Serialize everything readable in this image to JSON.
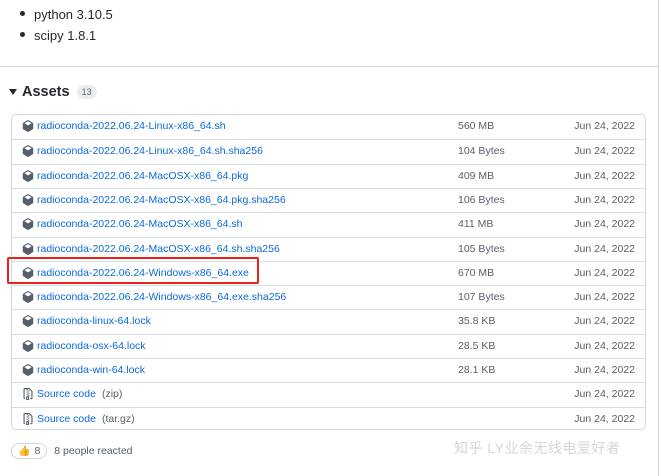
{
  "dependencies": [
    "python 3.10.5",
    "scipy 1.8.1"
  ],
  "assets": {
    "title": "Assets",
    "count": "13",
    "rows": [
      {
        "name": "radioconda-2022.06.24-Linux-x86_64.sh",
        "sub": "",
        "size": "560 MB",
        "date": "Jun 24, 2022",
        "icon": "package-icon"
      },
      {
        "name": "radioconda-2022.06.24-Linux-x86_64.sh.sha256",
        "sub": "",
        "size": "104 Bytes",
        "date": "Jun 24, 2022",
        "icon": "package-icon"
      },
      {
        "name": "radioconda-2022.06.24-MacOSX-x86_64.pkg",
        "sub": "",
        "size": "409 MB",
        "date": "Jun 24, 2022",
        "icon": "package-icon"
      },
      {
        "name": "radioconda-2022.06.24-MacOSX-x86_64.pkg.sha256",
        "sub": "",
        "size": "106 Bytes",
        "date": "Jun 24, 2022",
        "icon": "package-icon"
      },
      {
        "name": "radioconda-2022.06.24-MacOSX-x86_64.sh",
        "sub": "",
        "size": "411 MB",
        "date": "Jun 24, 2022",
        "icon": "package-icon"
      },
      {
        "name": "radioconda-2022.06.24-MacOSX-x86_64.sh.sha256",
        "sub": "",
        "size": "105 Bytes",
        "date": "Jun 24, 2022",
        "icon": "package-icon"
      },
      {
        "name": "radioconda-2022.06.24-Windows-x86_64.exe",
        "sub": "",
        "size": "670 MB",
        "date": "Jun 24, 2022",
        "icon": "package-icon"
      },
      {
        "name": "radioconda-2022.06.24-Windows-x86_64.exe.sha256",
        "sub": "",
        "size": "107 Bytes",
        "date": "Jun 24, 2022",
        "icon": "package-icon"
      },
      {
        "name": "radioconda-linux-64.lock",
        "sub": "",
        "size": "35.8 KB",
        "date": "Jun 24, 2022",
        "icon": "package-icon"
      },
      {
        "name": "radioconda-osx-64.lock",
        "sub": "",
        "size": "28.5 KB",
        "date": "Jun 24, 2022",
        "icon": "package-icon"
      },
      {
        "name": "radioconda-win-64.lock",
        "sub": "",
        "size": "28.1 KB",
        "date": "Jun 24, 2022",
        "icon": "package-icon"
      },
      {
        "name": "Source code",
        "sub": "(zip)",
        "size": "",
        "date": "Jun 24, 2022",
        "icon": "file-zip-icon"
      },
      {
        "name": "Source code",
        "sub": "(tar.gz)",
        "size": "",
        "date": "Jun 24, 2022",
        "icon": "file-zip-icon"
      }
    ]
  },
  "reactions": {
    "emoji": "👍",
    "count": "8",
    "text": "8 people reacted"
  },
  "watermark": "知乎 LY业余无线电爱好者",
  "colors": {
    "link": "#0969da",
    "muted": "#57606a",
    "border": "#d0d7de",
    "highlight": "#e8231c"
  }
}
